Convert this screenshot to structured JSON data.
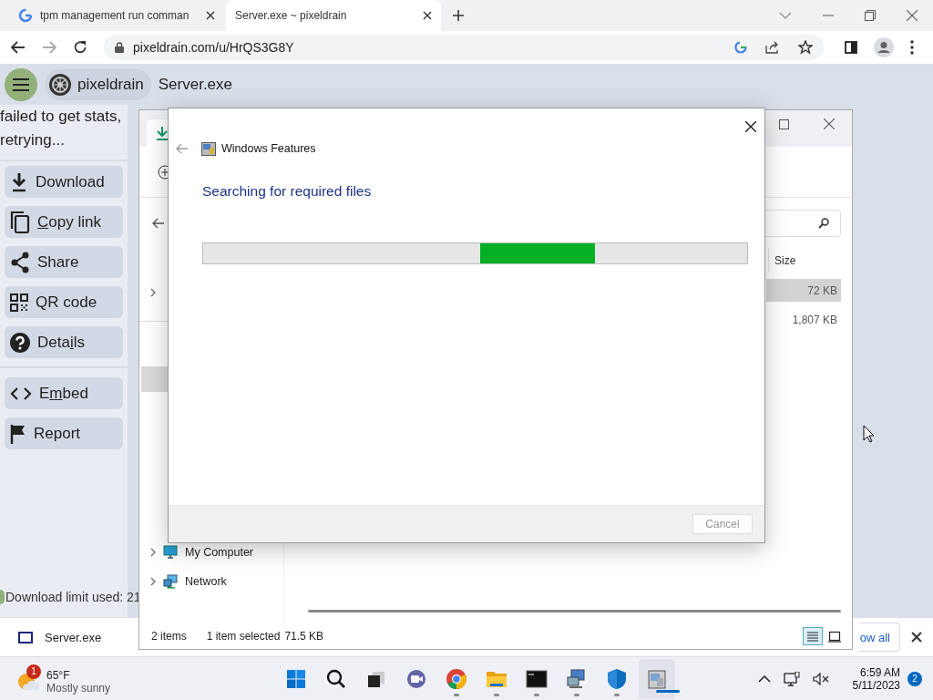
{
  "browser": {
    "tabs": [
      {
        "title": "tpm management run comman",
        "selected": false,
        "kind": "google"
      },
      {
        "title": "Server.exe ~ pixeldrain",
        "selected": true,
        "kind": "wheel"
      }
    ],
    "url": "pixeldrain.com/u/HrQS3G8Y",
    "page": {
      "logo": "pixeldrain",
      "file_name": "Server.exe",
      "stats_message": "failed to get stats, retrying...",
      "action_groups": [
        [
          {
            "kind": "download",
            "label_parts": [
              {
                "text": "Download",
                "underlined": false
              }
            ]
          },
          {
            "kind": "copy",
            "label_parts": [
              {
                "text": "C",
                "underlined": true
              },
              {
                "text": "opy link",
                "underlined": false
              }
            ]
          },
          {
            "kind": "share",
            "label_parts": [
              {
                "text": "Share",
                "underlined": false
              }
            ]
          },
          {
            "kind": "qr",
            "label_parts": [
              {
                "text": "QR code",
                "underlined": false
              }
            ]
          },
          {
            "kind": "help",
            "label_parts": [
              {
                "text": "Deta",
                "underlined": false
              },
              {
                "text": "i",
                "underlined": true
              },
              {
                "text": "ls",
                "underlined": false
              }
            ]
          }
        ],
        [
          {
            "kind": "embed",
            "label_parts": [
              {
                "text": "E",
                "underlined": false
              },
              {
                "text": "m",
                "underlined": true
              },
              {
                "text": "bed",
                "underlined": false
              }
            ]
          },
          {
            "kind": "flag",
            "label_parts": [
              {
                "text": "Report",
                "underlined": false
              }
            ]
          }
        ]
      ],
      "download_limit": "Download limit used: 21"
    },
    "download_bar": {
      "file": "Server.exe",
      "button": "ow all"
    }
  },
  "explorer": {
    "column": "Size",
    "rows": [
      {
        "size": "72 KB",
        "selected": true
      },
      {
        "size": "1,807 KB",
        "selected": false
      }
    ],
    "nav": [
      {
        "label": "My Computer",
        "kind": "computer"
      },
      {
        "label": "Network",
        "kind": "network"
      }
    ],
    "status": {
      "count": "2 items",
      "selection": "1 item selected",
      "size": "71.5 KB"
    },
    "views": [
      {
        "kind": "details",
        "selected": true
      },
      {
        "kind": "tiles",
        "selected": false
      }
    ]
  },
  "dialog": {
    "title": "Windows Features",
    "heading": "Searching for required files",
    "progress": {
      "indeterminate": true
    },
    "cancel": {
      "label": "Cancel",
      "disabled": true
    }
  },
  "taskbar": {
    "weather": {
      "badge": "1",
      "temperature": "65°F",
      "condition": "Mostly sunny"
    },
    "apps": [
      {
        "kind": "start",
        "running": false,
        "active": false
      },
      {
        "kind": "search",
        "running": false,
        "active": false
      },
      {
        "kind": "taskview",
        "running": false,
        "active": false
      },
      {
        "kind": "chat",
        "running": false,
        "active": false
      },
      {
        "kind": "chrome",
        "running": true,
        "active": false
      },
      {
        "kind": "folder",
        "running": true,
        "active": false
      },
      {
        "kind": "terminal",
        "running": true,
        "active": false
      },
      {
        "kind": "network",
        "running": true,
        "active": false
      },
      {
        "kind": "shield",
        "running": true,
        "active": false
      },
      {
        "kind": "features",
        "running": true,
        "active": true
      }
    ],
    "time": "6:59 AM",
    "date": "5/11/2023",
    "notifications": "2"
  }
}
